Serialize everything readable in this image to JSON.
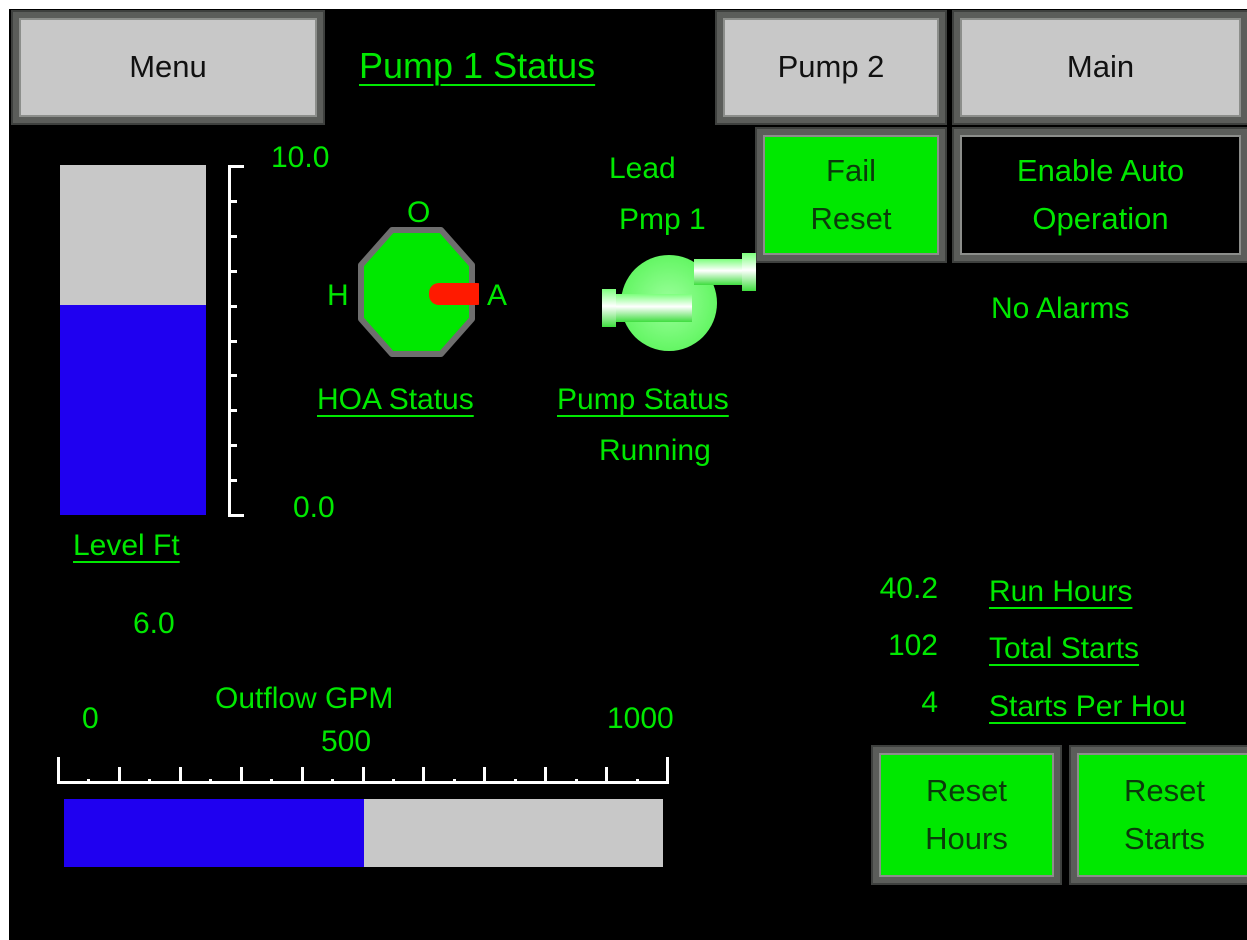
{
  "nav": {
    "menu": "Menu",
    "title": "Pump 1 Status",
    "pump2": "Pump 2",
    "main": "Main"
  },
  "buttons": {
    "fail_reset_1": "Fail",
    "fail_reset_2": "Reset",
    "enable_auto_1": "Enable Auto",
    "enable_auto_2": "Operation",
    "reset_hours_1": "Reset",
    "reset_hours_2": "Hours",
    "reset_starts_1": "Reset",
    "reset_starts_2": "Starts"
  },
  "level": {
    "label": "Level Ft",
    "max_label": "10.0",
    "min_label": "0.0",
    "value_text": "6.0",
    "value": 6.0,
    "max": 10.0
  },
  "hoa": {
    "o": "O",
    "h": "H",
    "a": "A",
    "label": "HOA Status",
    "position": "A"
  },
  "pump": {
    "lead_1": "Lead",
    "lead_2": "Pmp 1",
    "label": "Pump Status",
    "state": "Running",
    "icon": "centrifugal-pump-icon"
  },
  "alarms": "No Alarms",
  "outflow": {
    "label": "Outflow GPM",
    "min_label": "0",
    "mid_label": "500",
    "max_label": "1000",
    "value": 500,
    "max": 1000
  },
  "stats": [
    {
      "value": "40.2",
      "label": "Run Hours"
    },
    {
      "value": "102",
      "label": "Total Starts"
    },
    {
      "value": "4",
      "label": "Starts Per Hou"
    }
  ],
  "colors": {
    "background": "#000000",
    "text": "#00e800",
    "bar_fill": "#1f00f0",
    "bar_empty": "#c8c8c8",
    "button_gray": "#c8c8c8",
    "button_green": "#00e800",
    "hoa_pointer": "#ff1a00"
  }
}
